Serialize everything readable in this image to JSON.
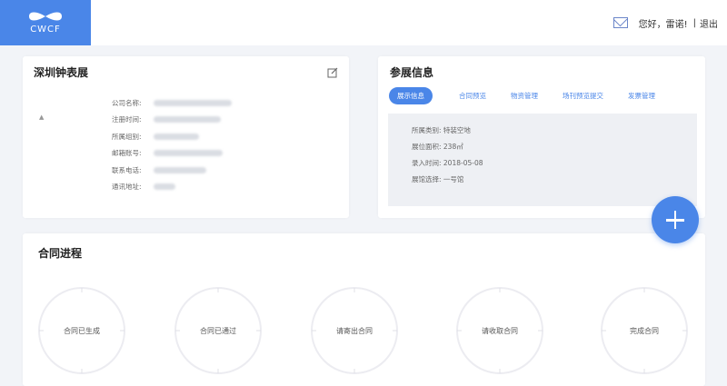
{
  "header": {
    "logo_text": "CWCF",
    "greeting": "您好，雷诺!",
    "separator": "|",
    "logout": "退出"
  },
  "exhibitor": {
    "title": "深圳钟表展",
    "placeholder_mark": "▲",
    "fields": [
      {
        "label": "公司名称:"
      },
      {
        "label": "注册时间:"
      },
      {
        "label": "所属组别:"
      },
      {
        "label": "邮箱账号:"
      },
      {
        "label": "联系电话:"
      },
      {
        "label": "通讯地址:"
      }
    ]
  },
  "participation": {
    "title": "参展信息",
    "tabs": [
      "展示信息",
      "合同预览",
      "物资管理",
      "场刊预览提交",
      "发票管理"
    ],
    "active_tab": 0,
    "details": [
      "所属类别: 特装空地",
      "展位面积: 238㎡",
      "录入时间: 2018-05-08",
      "展馆选择: 一号馆"
    ]
  },
  "contract": {
    "title": "合同进程",
    "steps": [
      "合同已生成",
      "合同已通过",
      "请寄出合同",
      "请收取合同",
      "完成合同"
    ]
  },
  "colors": {
    "accent": "#4a86e8",
    "background": "#f2f4f8",
    "panel": "#eef0f4"
  },
  "icons": {
    "mail": "mail-icon",
    "edit": "edit-icon",
    "add": "plus-icon",
    "logo": "infinity-logo-icon"
  }
}
